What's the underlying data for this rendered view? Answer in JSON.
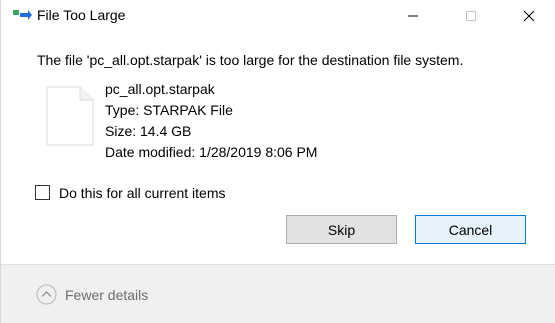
{
  "window": {
    "title": "File Too Large",
    "icon": "file-move-icon"
  },
  "titlebar_buttons": {
    "minimize_icon": "minimize-icon",
    "maximize_icon": "maximize-icon",
    "close_icon": "close-icon"
  },
  "message": "The file 'pc_all.opt.starpak' is too large for the destination file system.",
  "file": {
    "icon": "file-icon",
    "name": "pc_all.opt.starpak",
    "type": "Type: STARPAK File",
    "size": "Size: 14.4 GB",
    "date_modified": "Date modified: 1/28/2019 8:06 PM"
  },
  "option": {
    "label": "Do this for all current items",
    "checked": false
  },
  "buttons": {
    "skip": "Skip",
    "cancel": "Cancel"
  },
  "details": {
    "label": "Fewer details",
    "icon": "chevron-up-icon"
  },
  "colors": {
    "accent": "#0078d7",
    "button_bg": "#e1e1e1",
    "details_bg": "#f0f0f0"
  }
}
